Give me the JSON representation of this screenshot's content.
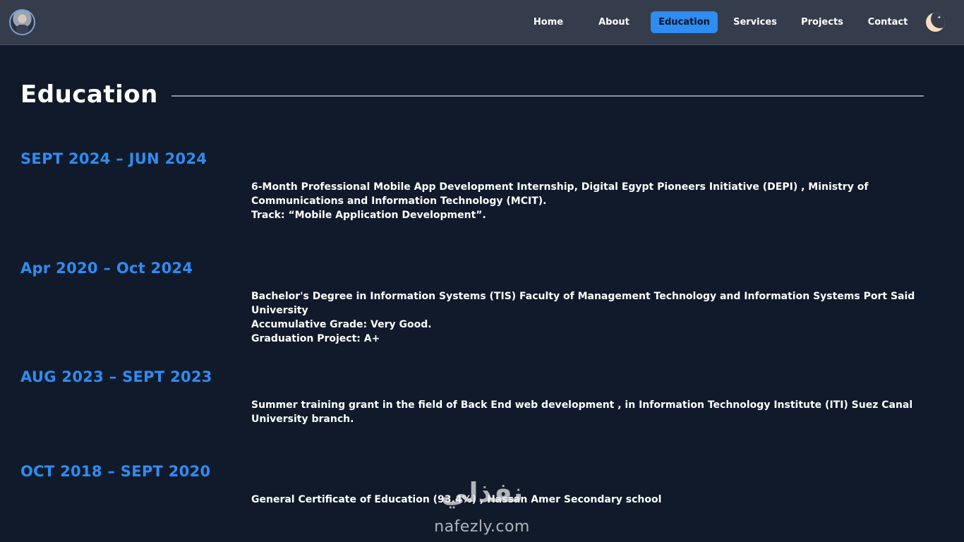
{
  "nav": {
    "items": [
      {
        "label": "Home",
        "active": false
      },
      {
        "label": "About",
        "active": false
      },
      {
        "label": "Education",
        "active": true
      },
      {
        "label": "Services",
        "active": false
      },
      {
        "label": "Projects",
        "active": false
      },
      {
        "label": "Contact",
        "active": false
      }
    ],
    "avatar_icon": "profile-photo",
    "theme_icon": "moon-icon"
  },
  "section": {
    "title": "Education"
  },
  "education": [
    {
      "date": "SEPT 2024 – JUN 2024",
      "lines": [
        "6-Month Professional Mobile App Development Internship, Digital Egypt Pioneers Initiative (DEPI) , Ministry of Communications and Information Technology (MCIT).",
        "Track: “Mobile Application Development”."
      ]
    },
    {
      "date": "Apr 2020 – Oct 2024",
      "lines": [
        "Bachelor's Degree in Information Systems (TIS) Faculty of Management Technology and Information Systems Port Said University",
        "Accumulative Grade: Very Good.",
        "Graduation Project: A+"
      ]
    },
    {
      "date": "AUG 2023 – SEPT 2023",
      "lines": [
        "Summer training grant in the field of Back End web development , in Information Technology Institute (ITI) Suez Canal University branch."
      ]
    },
    {
      "date": "OCT 2018 – SEPT 2020",
      "lines": [
        "General Certificate of Education (93.4%) , Hassan Amer Secondary school"
      ]
    }
  ],
  "watermark": {
    "arabic": "نفذلي",
    "latin": "nafezly.com"
  },
  "colors": {
    "accent": "#2f8cf0",
    "background": "#111a2b",
    "navbar": "#353c4c"
  }
}
